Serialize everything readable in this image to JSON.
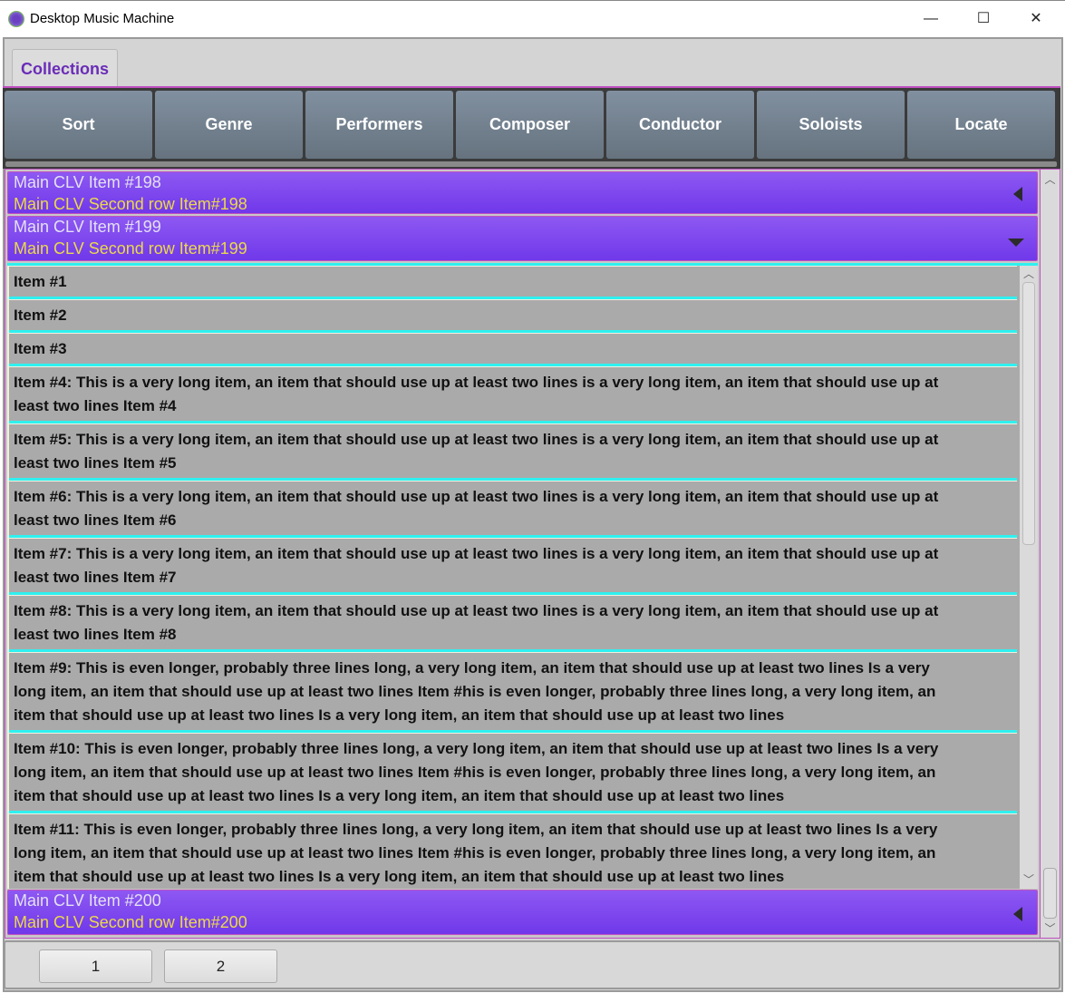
{
  "window": {
    "title": "Desktop Music Machine",
    "minimize": "—",
    "maximize": "☐",
    "close": "✕"
  },
  "tabs": [
    {
      "label": "Collections"
    }
  ],
  "toolbar": [
    "Sort",
    "Genre",
    "Performers",
    "Composer",
    "Conductor",
    "Soloists",
    "Locate"
  ],
  "headers": [
    {
      "line1": "Main CLV Item #198",
      "line2": "Main CLV Second row Item#198",
      "state": "collapsed"
    },
    {
      "line1": "Main CLV Item #199",
      "line2": "Main CLV Second row Item#199",
      "state": "expanded"
    },
    {
      "line1": "Main CLV Item #200",
      "line2": "Main CLV Second row Item#200",
      "state": "collapsed"
    }
  ],
  "items": [
    {
      "lines": [
        "Item #1"
      ]
    },
    {
      "lines": [
        "Item #2"
      ]
    },
    {
      "lines": [
        "Item #3"
      ]
    },
    {
      "lines": [
        "Item #4: This is a very long item, an item that should use up at least two lines  is a very long item, an item that should use up at",
        "least two lines Item #4"
      ]
    },
    {
      "lines": [
        "Item #5: This is a very long item, an item that should use up at least two lines  is a very long item, an item that should use up at",
        "least two lines Item #5"
      ]
    },
    {
      "lines": [
        "Item #6: This is a very long item, an item that should use up at least two lines  is a very long item, an item that should use up at",
        "least two lines Item #6"
      ]
    },
    {
      "lines": [
        "Item #7: This is a very long item, an item that should use up at least two lines  is a very long item, an item that should use up at",
        "least two lines Item #7"
      ]
    },
    {
      "lines": [
        "Item #8: This is a very long item, an item that should use up at least two lines  is a very long item, an item that should use up at",
        "least two lines Item #8"
      ]
    },
    {
      "lines": [
        "Item #9: This is even longer, probably three lines long, a very long item, an item that should use up at least two lines  Is a very",
        "long item, an item that should use up at least two lines  Item #his is even longer, probably three lines long, a very long item, an",
        "item that should use up  at least two lines  Is a very long item, an item that should use up at least two lines"
      ]
    },
    {
      "lines": [
        "Item #10: This is even longer, probably three lines long, a very long item, an item that should use up at least two lines  Is a very",
        "long item, an item that should use up at least two lines  Item #his is even longer, probably three lines long, a very long item, an",
        "item that should use up  at least two lines  Is a very long item, an item that should use up at least two lines"
      ]
    },
    {
      "lines": [
        "Item #11: This is even longer, probably three lines long, a very long item, an item that should use up at least two lines  Is a very",
        "long item, an item that should use up at least two lines  Item #his is even longer, probably three lines long, a very long item, an",
        "item that should use up  at least two lines  Is a very long item, an item that should use up at least two lines"
      ]
    }
  ],
  "pages": [
    "1",
    "2"
  ]
}
